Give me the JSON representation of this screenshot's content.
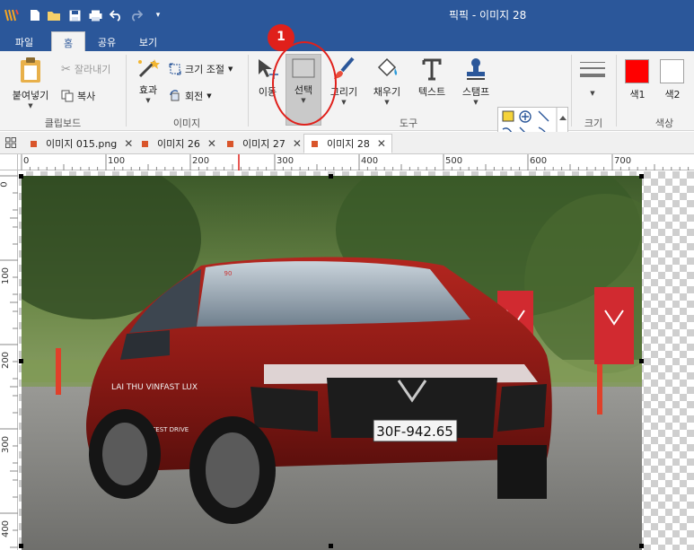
{
  "app": {
    "title": "픽픽 - 이미지 28",
    "quick_access": [
      "logo-icon",
      "new-file-icon",
      "open-folder-icon",
      "save-icon",
      "print-icon",
      "undo-icon",
      "redo-icon",
      "customize-icon"
    ]
  },
  "ribbon_tabs": [
    {
      "label": "파일"
    },
    {
      "label": "홈",
      "active": true
    },
    {
      "label": "공유"
    },
    {
      "label": "보기"
    }
  ],
  "clipboard": {
    "paste_label": "붙여넣기",
    "cut_label": "잘라내기",
    "copy_label": "복사",
    "group_label": "클립보드"
  },
  "image_group": {
    "effects_label": "효과",
    "resize_label": "크기 조절",
    "rotate_label": "회전",
    "group_label": "이미지"
  },
  "tools": {
    "move_label": "이동",
    "select_label": "선택",
    "draw_label": "그리기",
    "fill_label": "채우기",
    "text_label": "텍스트",
    "stamp_label": "스탬프",
    "group_label": "도구",
    "shape_gallery": [
      "rectangle-select-icon",
      "plus-circle-icon",
      "line-icon",
      "curve-icon",
      "arrow-icon",
      "curve-arrow-icon",
      "ellipse-icon",
      "rectangle-icon",
      "rounded-rectangle-icon"
    ]
  },
  "size_group": {
    "label": "크기"
  },
  "color_group": {
    "color1_label": "색1",
    "color2_label": "색2",
    "group_label": "색상",
    "color1": "#ff0000",
    "color2": "#ffffff"
  },
  "annotation": {
    "badge": "1",
    "color": "#e0201b"
  },
  "doc_tabs": [
    {
      "label": "이미지 015.png"
    },
    {
      "label": "이미지 26"
    },
    {
      "label": "이미지 27"
    },
    {
      "label": "이미지 28",
      "active": true
    }
  ],
  "ruler": {
    "horizontal": [
      "0",
      "100",
      "200",
      "300",
      "400",
      "500",
      "600",
      "700"
    ],
    "vertical": [
      "0",
      "100",
      "200",
      "300",
      "400"
    ]
  },
  "photo": {
    "plate": "30F-942.65",
    "door_text": "LAI THU\nVINFAST LUX",
    "door_text_2": "TEST DRIVE",
    "windshield_sticker": "90"
  },
  "colors": {
    "accent": "#2b579a",
    "tab_marker": "#d9552b"
  }
}
